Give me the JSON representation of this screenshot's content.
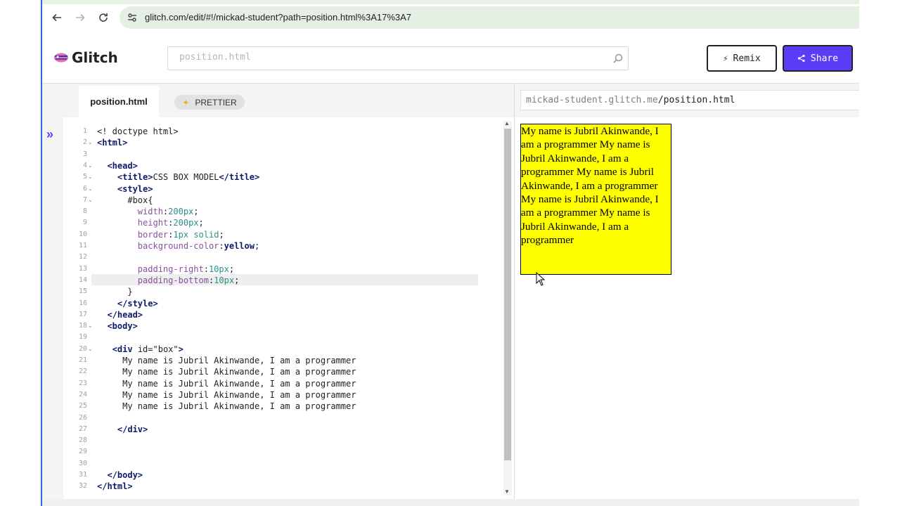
{
  "browser": {
    "url": "glitch.com/edit/#!/mickad-student?path=position.html%3A17%3A7",
    "icons": [
      "back-icon",
      "forward-icon",
      "reload-icon",
      "site-settings-icon"
    ]
  },
  "header": {
    "logo_text": "Glitch",
    "search_value": "position.html",
    "remix_label": "Remix",
    "share_label": "Share",
    "brand_color": "#5a3df6"
  },
  "editor": {
    "file_tab": "position.html",
    "prettier_label": "PRETTIER",
    "active_line": 14,
    "lines": [
      {
        "n": "1",
        "fold": "",
        "html": "&lt;! doctype html&gt;"
      },
      {
        "n": "2",
        "fold": "v",
        "html": "<span class='tag'>&lt;html&gt;</span>"
      },
      {
        "n": "3",
        "fold": "",
        "html": ""
      },
      {
        "n": "4",
        "fold": "v",
        "html": "  <span class='tag'>&lt;head&gt;</span>"
      },
      {
        "n": "5",
        "fold": "v",
        "html": "    <span class='tag'>&lt;title&gt;</span>CSS BOX MODEL<span class='tag'>&lt;/title&gt;</span>"
      },
      {
        "n": "6",
        "fold": "v",
        "html": "    <span class='tag'>&lt;style&gt;</span>"
      },
      {
        "n": "7",
        "fold": "v",
        "html": "      #box{"
      },
      {
        "n": "8",
        "fold": "",
        "html": "        <span class='prop'>width</span>:<span class='num'>200px</span>;"
      },
      {
        "n": "9",
        "fold": "",
        "html": "        <span class='prop'>height</span>:<span class='num'>200px</span>;"
      },
      {
        "n": "10",
        "fold": "",
        "html": "        <span class='prop'>border</span>:<span class='num'>1px</span> <span class='num'>solid</span>;"
      },
      {
        "n": "11",
        "fold": "",
        "html": "        <span class='prop'>background-color</span>:<span class='kw'>yellow</span>;"
      },
      {
        "n": "12",
        "fold": "",
        "html": ""
      },
      {
        "n": "13",
        "fold": "",
        "html": "        <span class='prop'>padding-right</span>:<span class='num'>10px</span>;"
      },
      {
        "n": "14",
        "fold": "",
        "html": "        <span class='prop'>padding-bottom</span>:<span class='num'>10px</span>;"
      },
      {
        "n": "15",
        "fold": "",
        "html": "      }"
      },
      {
        "n": "16",
        "fold": "",
        "html": "    <span class='tag'>&lt;/style&gt;</span>"
      },
      {
        "n": "17",
        "fold": "",
        "html": "  <span class='tag'>&lt;/head&gt;</span>"
      },
      {
        "n": "18",
        "fold": "v",
        "html": "  <span class='tag'>&lt;body&gt;</span>"
      },
      {
        "n": "19",
        "fold": "",
        "html": ""
      },
      {
        "n": "20",
        "fold": "v",
        "html": "   <span class='tag'>&lt;div</span> id=\"box\"<span class='tag'>&gt;</span>"
      },
      {
        "n": "21",
        "fold": "",
        "html": "     My name is Jubril Akinwande, I am a programmer"
      },
      {
        "n": "22",
        "fold": "",
        "html": "     My name is Jubril Akinwande, I am a programmer"
      },
      {
        "n": "23",
        "fold": "",
        "html": "     My name is Jubril Akinwande, I am a programmer"
      },
      {
        "n": "24",
        "fold": "",
        "html": "     My name is Jubril Akinwande, I am a programmer"
      },
      {
        "n": "25",
        "fold": "",
        "html": "     My name is Jubril Akinwande, I am a programmer"
      },
      {
        "n": "26",
        "fold": "",
        "html": ""
      },
      {
        "n": "27",
        "fold": "",
        "html": "    <span class='tag'>&lt;/div&gt;</span>"
      },
      {
        "n": "28",
        "fold": "",
        "html": ""
      },
      {
        "n": "29",
        "fold": "",
        "html": ""
      },
      {
        "n": "30",
        "fold": "",
        "html": ""
      },
      {
        "n": "31",
        "fold": "",
        "html": "  <span class='tag'>&lt;/body&gt;</span>"
      },
      {
        "n": "32",
        "fold": "",
        "html": "<span class='tag'>&lt;/html&gt;</span>"
      }
    ]
  },
  "preview": {
    "url_host": "mickad-student.glitch.me",
    "url_path": "/position.html",
    "box_text": "My name is Jubril Akinwande, I am a programmer My name is Jubril Akinwande, I am a programmer My name is Jubril Akinwande, I am a programmer My name is Jubril Akinwande, I am a programmer My name is Jubril Akinwande, I am a programmer",
    "box_color": "#ffff00"
  }
}
